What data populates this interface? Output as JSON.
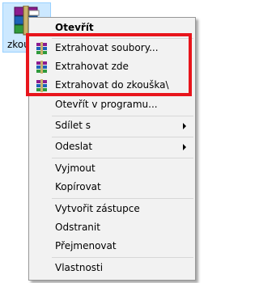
{
  "desktop_icon": {
    "label": "zkouška"
  },
  "menu": {
    "items": [
      {
        "label": "Otevřít"
      },
      {
        "label": "Extrahovat soubory..."
      },
      {
        "label": "Extrahovat zde"
      },
      {
        "label": "Extrahovat do zkouška\\"
      },
      {
        "label": "Otevřít v programu..."
      },
      {
        "label": "Sdílet s"
      },
      {
        "label": "Odeslat"
      },
      {
        "label": "Vyjmout"
      },
      {
        "label": "Kopírovat"
      },
      {
        "label": "Vytvořit zástupce"
      },
      {
        "label": "Odstranit"
      },
      {
        "label": "Přejmenovat"
      },
      {
        "label": "Vlastnosti"
      }
    ]
  },
  "colors": {
    "highlight": "#e8151c",
    "menu_bg": "#f2f2f2",
    "selection": "#cce8ff"
  },
  "icons": {
    "archive": "winrar-archive-icon",
    "submenu": "chevron-right-icon"
  }
}
